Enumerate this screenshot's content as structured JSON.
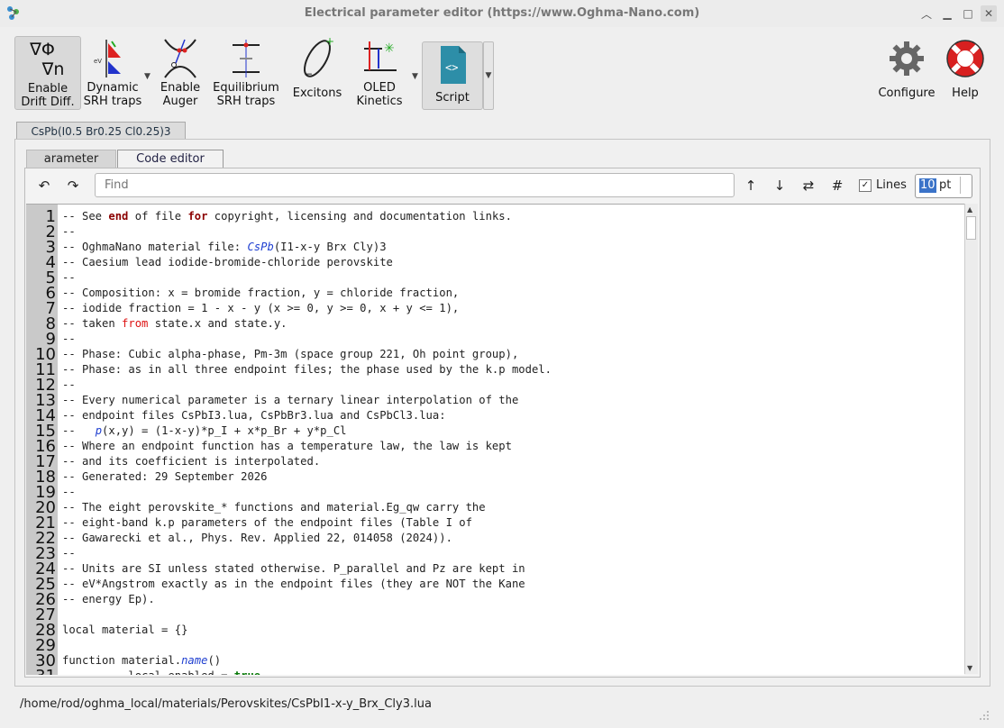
{
  "window": {
    "title": "Electrical parameter editor (https://www.Oghma-Nano.com)"
  },
  "toolbar": {
    "drift": {
      "icon_top": "∇Φ",
      "icon_bottom": "∇n",
      "line1": "Enable",
      "line2": "Drift Diff."
    },
    "srh": {
      "line1": "Dynamic",
      "line2": "SRH traps",
      "icon_label": "eV"
    },
    "auger": {
      "line1": "Enable",
      "line2": "Auger"
    },
    "eq": {
      "line1": "Equilibrium",
      "line2": "SRH traps"
    },
    "excitons": {
      "label": "Excitons"
    },
    "oled": {
      "line1": "OLED",
      "line2": "Kinetics"
    },
    "script": {
      "label": "Script",
      "icon_text": "<>"
    },
    "configure": {
      "label": "Configure"
    },
    "help": {
      "label": "Help"
    }
  },
  "material_tab": "CsPb(I0.5 Br0.25 Cl0.25)3",
  "subtabs": {
    "a": "arameter",
    "b": "Code editor"
  },
  "editor_toolbar": {
    "undo": "↶",
    "redo": "↷",
    "find_placeholder": "Find",
    "up": "↑",
    "down": "↓",
    "swap": "⇄",
    "hash": "#",
    "lines_label": "Lines",
    "lines_checked": "✓",
    "font_size": "10",
    "font_unit": "pt"
  },
  "line_numbers": [
    "1",
    "2",
    "3",
    "4",
    "5",
    "6",
    "7",
    "8",
    "9",
    "10",
    "11",
    "12",
    "13",
    "14",
    "15",
    "16",
    "17",
    "18",
    "19",
    "20",
    "21",
    "22",
    "23",
    "24",
    "25",
    "26",
    "27",
    "28",
    "29",
    "30",
    "31"
  ],
  "code_lines": [
    [
      {
        "t": "-- See "
      },
      {
        "t": "end",
        "c": "kw"
      },
      {
        "t": " of file "
      },
      {
        "t": "for",
        "c": "kw"
      },
      {
        "t": " copyright, licensing and documentation links."
      }
    ],
    [
      {
        "t": "--"
      }
    ],
    [
      {
        "t": "-- OghmaNano material file: "
      },
      {
        "t": "CsPb",
        "c": "fn"
      },
      {
        "t": "(I1-x-y Brx Cly)3"
      }
    ],
    [
      {
        "t": "-- Caesium lead iodide-bromide-chloride perovskite"
      }
    ],
    [
      {
        "t": "--"
      }
    ],
    [
      {
        "t": "-- Composition: x = bromide fraction, y = chloride fraction,"
      }
    ],
    [
      {
        "t": "-- iodide fraction = 1 - x - y (x >= 0, y >= 0, x + y <= 1),"
      }
    ],
    [
      {
        "t": "-- taken "
      },
      {
        "t": "from",
        "c": "kwr"
      },
      {
        "t": " state.x and state.y."
      }
    ],
    [
      {
        "t": "--"
      }
    ],
    [
      {
        "t": "-- Phase: Cubic alpha-phase, Pm-3m (space group 221, Oh point group),"
      }
    ],
    [
      {
        "t": "-- Phase: as in all three endpoint files; the phase used by the k.p model."
      }
    ],
    [
      {
        "t": "--"
      }
    ],
    [
      {
        "t": "-- Every numerical parameter is a ternary linear interpolation of the"
      }
    ],
    [
      {
        "t": "-- endpoint files CsPbI3.lua, CsPbBr3.lua and CsPbCl3.lua:"
      }
    ],
    [
      {
        "t": "--   "
      },
      {
        "t": "p",
        "c": "fn"
      },
      {
        "t": "(x,y) = (1-x-y)*p_I + x*p_Br + y*p_Cl"
      }
    ],
    [
      {
        "t": "-- Where an endpoint function has a temperature law, the law is kept"
      }
    ],
    [
      {
        "t": "-- and its coefficient is interpolated."
      }
    ],
    [
      {
        "t": "-- Generated: 29 September 2026"
      }
    ],
    [
      {
        "t": "--"
      }
    ],
    [
      {
        "t": "-- The eight perovskite_* functions and material.Eg_qw carry the"
      }
    ],
    [
      {
        "t": "-- eight-band k.p parameters of the endpoint files (Table I of"
      }
    ],
    [
      {
        "t": "-- Gawarecki et al., Phys. Rev. Applied 22, 014058 (2024))."
      }
    ],
    [
      {
        "t": "--"
      }
    ],
    [
      {
        "t": "-- Units are SI unless stated otherwise. P_parallel and Pz are kept in"
      }
    ],
    [
      {
        "t": "-- eV*Angstrom exactly as in the endpoint files (they are NOT the Kane"
      }
    ],
    [
      {
        "t": "-- energy Ep)."
      }
    ],
    [
      {
        "t": ""
      }
    ],
    [
      {
        "t": "local material = {}"
      }
    ],
    [
      {
        "t": ""
      }
    ],
    [
      {
        "t": "function material."
      },
      {
        "t": "name",
        "c": "fn"
      },
      {
        "t": "()"
      }
    ],
    [
      {
        "t": "          local enabled = "
      },
      {
        "t": "true",
        "c": "kwg"
      }
    ]
  ],
  "status_path": "/home/rod/oghma_local/materials/Perovskites/CsPbI1-x-y_Brx_Cly3.lua"
}
